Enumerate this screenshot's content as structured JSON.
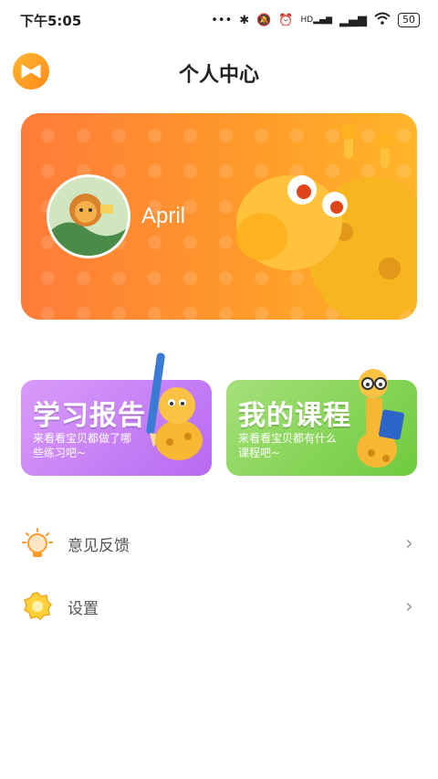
{
  "statusbar": {
    "time": "下午5:05",
    "dots": "•••",
    "hd_label": "HD",
    "battery": "50"
  },
  "header": {
    "title": "个人中心"
  },
  "profile": {
    "username": "April"
  },
  "tiles": [
    {
      "title": "学习报告",
      "subtitle": "来看看宝贝都做了哪些练习吧~"
    },
    {
      "title": "我的课程",
      "subtitle": "来看看宝贝都有什么课程吧~"
    }
  ],
  "menu": [
    {
      "label": "意见反馈",
      "icon": "lightbulb-icon"
    },
    {
      "label": "设置",
      "icon": "gear-icon"
    }
  ],
  "colors": {
    "accent_orange": "#ff9c2a",
    "report_purple": "#c47ff5",
    "course_green": "#86d257"
  }
}
